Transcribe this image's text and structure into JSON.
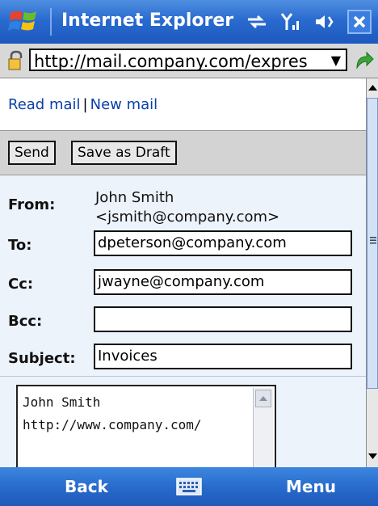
{
  "titlebar": {
    "title": "Internet Explorer",
    "icons": [
      "windows-logo-icon",
      "connectivity-icon",
      "signal-icon",
      "volume-icon",
      "close-icon"
    ]
  },
  "address": {
    "url": "http://mail.company.com/expres",
    "icons": [
      "lock-icon",
      "dropdown-arrow-icon",
      "go-arrow-icon"
    ]
  },
  "links": {
    "read_mail": "Read mail",
    "separator": "|",
    "new_mail": "New mail"
  },
  "toolbar": {
    "send_label": "Send",
    "draft_label": "Save as Draft"
  },
  "form": {
    "from_label": "From:",
    "from_name": "John Smith",
    "from_email": "<jsmith@company.com>",
    "to_label": "To:",
    "to_value": "dpeterson@company.com",
    "cc_label": "Cc:",
    "cc_value": "jwayne@company.com",
    "bcc_label": "Bcc:",
    "bcc_value": "",
    "subject_label": "Subject:",
    "subject_value": "Invoices"
  },
  "body": {
    "text": "John Smith\nhttp://www.company.com/"
  },
  "softkeys": {
    "left": "Back",
    "right": "Menu",
    "center_icon": "keyboard-icon"
  },
  "colors": {
    "titlebar": "#2a6bd0",
    "link": "#0a3fa8",
    "form_bg": "#edf3fb"
  }
}
